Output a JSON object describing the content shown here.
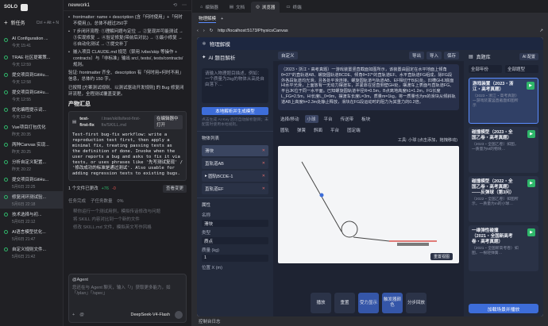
{
  "app": {
    "logo": "SOLO"
  },
  "sidebar": {
    "new_task": "新任务",
    "new_task_kbd": "Ctrl + Alt + N",
    "tasks": [
      {
        "title": "AI Configuration ...",
        "time": "今天 15:41"
      },
      {
        "title": "TRAE 社区提案策...",
        "time": "今天 12:59"
      },
      {
        "title": "提交项目到GitHu...",
        "time": "今天 12:58"
      },
      {
        "title": "提交项目到GitHu...",
        "time": "今天 12:55"
      },
      {
        "title": "优化编程提示词...",
        "time": "今天 12:42"
      },
      {
        "title": "Vue项目打包优化",
        "time": "昨天 20:35"
      },
      {
        "title": "两种Canvas 实现...",
        "time": "昨天 20:25"
      },
      {
        "title": "分析自定义配置...",
        "time": "昨天 20:22"
      },
      {
        "title": "提交项目到GitHu...",
        "time": "5月6日 22:25"
      },
      {
        "title": "修复闭环测试验...",
        "time": "5月6日 22:18"
      },
      {
        "title": "技术选择与初...",
        "time": "5月6日 22:12"
      },
      {
        "title": "AI语言模型优化...",
        "time": "5月6日 21:47"
      },
      {
        "title": "自定义规则文件...",
        "time": "5月6日 21:42"
      }
    ]
  },
  "chat": {
    "workspace": "newwork1",
    "lines": [
      "frontmatter: name + description (含「何时使用」+「何时不使用」)，总体不超过250字",
      "7 步闭环流程: ①理解问题与定位 → ②复现并可能测试 → ③实现修复 → ④验证修复(带前后对比) → ⑤最小修复 → ⑥自动化测试 → ⑦提交补丁",
      "嵌入项目 CLAUDE.md 规范（禁用 /vibe/skip 等操作 + contracts）与「非标准」输出 src/, tests/, tests/contracts/ 规则。",
      "验证: frontmatter 齐全、description 有「何时用+何时不用」信息，总体约 150 字。",
      "已按照 [方案测试规则、以测试驱动开发规则] 的 Bug 修复闭环流程，全程测试覆盖变更。"
    ],
    "summary_title": "产物汇总",
    "file": {
      "name": "test-first-fix",
      "path": "/.trae/skills/test-first-fix/SKILL.md",
      "btn": "在编辑器中打开"
    },
    "code": "Test-first bug-fix workflow: write a reproduction test first, then apply a minimal fix, treating passing tests as the definition of done. Invoke when the user reports a bug and asks to fix it via tests, or uses phrases like '先写测试复现' / '修改成功的标准是通过测试'. Also usable for adding regression tests to existing bugs.",
    "changes_label": "1 个文件已更改",
    "changes_plus": "+76",
    "changes_minus": "-0",
    "view_label": "查看变更",
    "tasks_label": "任务完成",
    "subtasks_label": "子任务数量",
    "progress": "0%",
    "followups": [
      "帮你运行一个测试用例，模拟传话修改与问题",
      "将 SKILL 内容对比到一个新的文件",
      "修改 SKILL.md 文件，模拟英文写作风格"
    ],
    "agent_tag": "@Agent",
    "placeholder": "您还在与 Agent 聊天，输入「/」获取更多能力，如「/plan」「/spec」",
    "model": "DeepSeek-V4-Flash"
  },
  "browser": {
    "tabs": [
      "编辑器",
      "文档",
      "浏览器",
      "终端"
    ],
    "url": "http://localhost:5173/PhysicsCanvas",
    "status": "控制台日志"
  },
  "physics": {
    "title": "物理解模",
    "left_tabs": [
      "AI 题目解析"
    ],
    "input_placeholder": "请输入物理题目描述，例如：一个质量为2kg的物体从高处自由落下…",
    "gen_btn": "本地解析并生成模型",
    "hint": "点击生成 AI Key 后可自动解析题目；未配置时使用本地规则。",
    "objects_title": "物体列表",
    "objects": [
      "滑块",
      "直轨道AB",
      "圆轨BCDE-1",
      "直轨道EF"
    ],
    "props_title": "属性",
    "props": [
      {
        "label": "名称",
        "value": "滑块"
      },
      {
        "label": "类型",
        "value": "质点"
      },
      {
        "label": "质量 (kg)",
        "value": "1"
      },
      {
        "label": "位置 X (m)",
        "value": ""
      }
    ],
    "canvas_tabs": [
      "自定义"
    ],
    "canvas_chips": [
      "导出",
      "导入",
      "保存"
    ],
    "problem": "（2023・浙江・高考真题）一游戏装置竖直截面如图所示，该装置由固定在水平地面上倾角θ=37°的直轨道AB、螺旋圆轨道BCDE、倾角θ=37°的直轨道EF、水平直轨道FG组成，除FG段外各段轨道均光滑，且各处平滑连接。螺旋圆轨道与轨道AB、EF相切于B(E)处。凹槽GHIJ底面HI水平光滑，上面放有一无动力摆渡车，并紧靠在竖直侧壁GH处，摆渡车上表面与直轨道FG、平台JK位于同一水平面。已知螺旋圆轨道半径R=0.5m，B点离地高度h1=1.2m，FG长度L_FG=2.5m，HI长度L_0=9m，摆渡车长度L=3m，质量m=1kg，将一质量也为m的滑块从倾斜轨道AB上高度h=2.3m处静止释放，滑块在FG段运动时的阻力为其重力的0.2倍。",
    "tools": [
      "选择/移动",
      "小球",
      "平台",
      "传送带",
      "板块"
    ],
    "tools2": [
      "圆轨",
      "弹簧",
      "斜面",
      "平台",
      "固定端"
    ],
    "tool_hint": "工具: 小球 (点击添加，拖拽移动)",
    "reset": "重置视图",
    "controls": [
      "播放",
      "重置",
      "受力显示",
      "触发器颜色",
      "分步回放"
    ],
    "right_title": "真题库",
    "ai_btn": "AI 配置",
    "filters": [
      "全部年份",
      "全部题型"
    ],
    "cards": [
      {
        "title": "游戏装置（2023・浙江・高考真题）",
        "desc": "（2023・浙江・高考真题）一游戏装置竖直截面如图所示"
      },
      {
        "title": "碰撞模型（2023・全国乙卷・高考真题）",
        "desc": "（2023・全国乙卷）如图，一质量为M的物块…"
      },
      {
        "title": "碰撞模型（2022・全国乙卷・高考真题）——反弹球（第3问）",
        "desc": "（2022・全国乙卷）如图所示，一质量为m的小球…"
      },
      {
        "title": "一维弹性碰撞（2021・全国新高考卷・高考真题）",
        "desc": "（2021・全国新高考卷）如图，一根轻弹簧…"
      },
      {
        "title": "水平传送带模型（2020・全国I卷・高考真题）",
        "desc": ""
      }
    ],
    "load_btn": "加载场景并播放"
  }
}
